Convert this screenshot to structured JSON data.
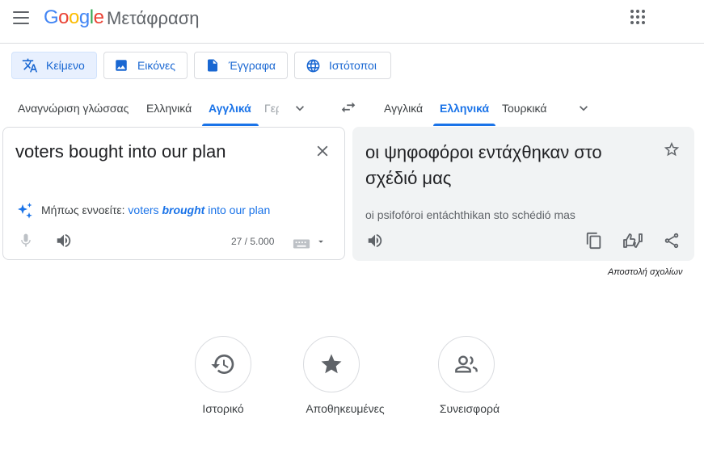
{
  "header": {
    "logo_letters": [
      "G",
      "o",
      "o",
      "g",
      "l",
      "e"
    ],
    "logo_colors": [
      "#4285F4",
      "#EA4335",
      "#FBBC05",
      "#4285F4",
      "#34A853",
      "#EA4335"
    ],
    "product_name": "Μετάφραση"
  },
  "modes": [
    {
      "label": "Κείμενο",
      "icon": "translate-icon",
      "active": true
    },
    {
      "label": "Εικόνες",
      "icon": "image-icon",
      "active": false
    },
    {
      "label": "Έγγραφα",
      "icon": "document-icon",
      "active": false
    },
    {
      "label": "Ιστότοποι",
      "icon": "globe-icon",
      "active": false
    }
  ],
  "source_languages": {
    "detect": "Αναγνώριση γλώσσας",
    "lang1": "Ελληνικά",
    "lang2": "Αγγλικά",
    "lang3_partial": "Γερμανικά",
    "selected": "Αγγλικά"
  },
  "target_languages": {
    "lang1": "Αγγλικά",
    "lang2": "Ελληνικά",
    "lang3": "Τουρκικά",
    "selected": "Ελληνικά"
  },
  "source": {
    "text": "voters bought into our plan",
    "suggestion_prefix": "Μήπως εννοείτε:",
    "suggestion_before": "voters ",
    "suggestion_emph": "brought",
    "suggestion_after": " into our plan",
    "char_count": "27 / 5.000"
  },
  "target": {
    "text": "οι ψηφοφόροι εντάχθηκαν στο σχέδιό μας",
    "transliteration": "oi psifofóroi entáchthikan sto schédió mas"
  },
  "feedback_link": "Αποστολή σχολίων",
  "bottom": [
    {
      "label": "Ιστορικό",
      "icon": "history-icon"
    },
    {
      "label": "Αποθηκευμένες",
      "icon": "star-icon"
    },
    {
      "label": "Συνεισφορά",
      "icon": "community-icon"
    }
  ],
  "colors": {
    "accent": "#1a73e8",
    "icon_gray": "#5f6368"
  }
}
